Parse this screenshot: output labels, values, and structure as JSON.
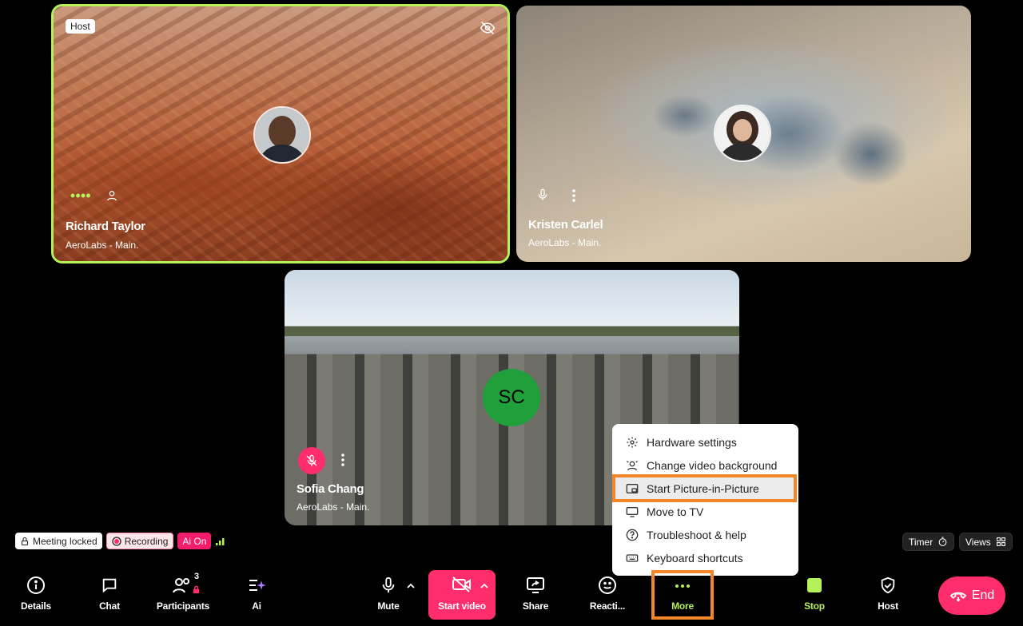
{
  "tiles": [
    {
      "name": "Richard Taylor",
      "subtitle": "AeroLabs - Main.",
      "badge": "Host"
    },
    {
      "name": "Kristen Carlel",
      "subtitle": "AeroLabs - Main."
    },
    {
      "name": "Sofia Chang",
      "subtitle": "AeroLabs - Main.",
      "initials": "SC"
    }
  ],
  "more_menu": {
    "items": [
      {
        "label": "Hardware settings",
        "icon": "gear-icon"
      },
      {
        "label": "Change video background",
        "icon": "background-icon"
      },
      {
        "label": "Start Picture-in-Picture",
        "icon": "pip-icon",
        "highlighted": true
      },
      {
        "label": "Move to TV",
        "icon": "tv-icon"
      },
      {
        "label": "Troubleshoot & help",
        "icon": "help-icon"
      },
      {
        "label": "Keyboard shortcuts",
        "icon": "keyboard-icon"
      }
    ]
  },
  "status": {
    "locked": "Meeting locked",
    "recording": "Recording",
    "ai": "Ai On"
  },
  "right_pills": {
    "timer": "Timer",
    "views": "Views"
  },
  "toolbar": {
    "details": "Details",
    "chat": "Chat",
    "participants": "Participants",
    "participants_count": "3",
    "ai": "Ai",
    "mute": "Mute",
    "start_video": "Start video",
    "share": "Share",
    "reactions": "Reacti...",
    "more": "More",
    "stop": "Stop",
    "host": "Host",
    "end": "End"
  },
  "colors": {
    "accent_green": "#b5f15b",
    "danger": "#ff2d6b",
    "highlight": "#f4862a"
  }
}
